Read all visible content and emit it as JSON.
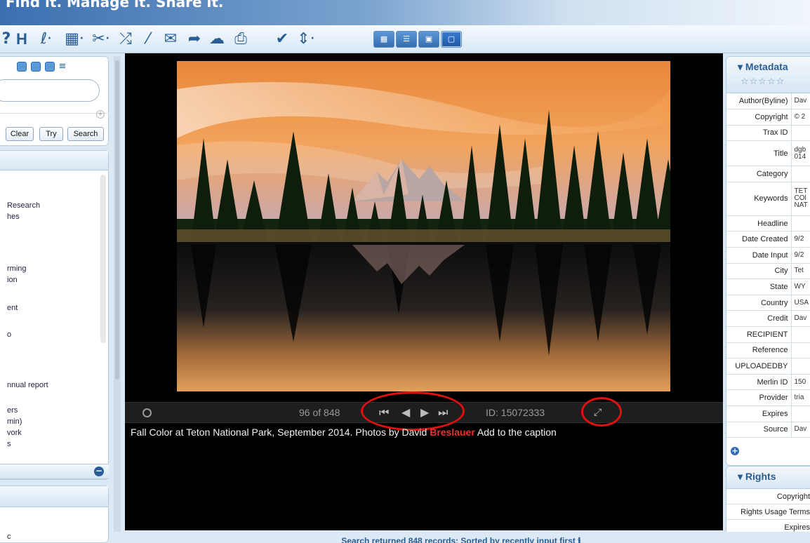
{
  "header": {
    "tagline": "Find it. Manage it. Share it."
  },
  "toolbar": {
    "icons": [
      "help-icon",
      "h-icon",
      "branch-icon",
      "calendar-icon",
      "scissors-icon",
      "shuffle-icon",
      "magic-wand-icon",
      "envelope-icon",
      "share-arrow-icon",
      "cloud-upload-icon",
      "printer-icon",
      "checkmark-icon",
      "sort-icon"
    ],
    "view_buttons": [
      "grid-view",
      "list-view",
      "image-view",
      "slideshow-view"
    ]
  },
  "left_panel": {
    "buttons": {
      "clear": "Clear",
      "try": "Try",
      "search": "Search"
    },
    "items": [
      "Research",
      "hes",
      "rming",
      "ion",
      "ent",
      "o",
      "nnual report",
      "ers",
      "min)",
      "vork",
      "s"
    ],
    "bottom_fragment": "c"
  },
  "viewer": {
    "counter": "96 of 848",
    "id_label": "ID: 15072333",
    "caption_before": "Fall Color at Teton National Park, September 2014. Photos by David ",
    "caption_highlight": "Breslauer",
    "caption_after": " Add to the caption"
  },
  "metadata": {
    "title": "Metadata",
    "stars": "☆☆☆☆☆",
    "rows": [
      {
        "key": "Author(Byline)",
        "value": "Dav"
      },
      {
        "key": "Copyright",
        "value": "© 2"
      },
      {
        "key": "Trax ID",
        "value": ""
      },
      {
        "key": "Title",
        "value": "dgb\n014"
      },
      {
        "key": "Category",
        "value": ""
      },
      {
        "key": "Keywords",
        "value": "TET\nCOl\nNAT"
      },
      {
        "key": "Headline",
        "value": ""
      },
      {
        "key": "Date Created",
        "value": "9/2"
      },
      {
        "key": "Date Input",
        "value": "9/2"
      },
      {
        "key": "City",
        "value": "Tet"
      },
      {
        "key": "State",
        "value": "WY"
      },
      {
        "key": "Country",
        "value": "USA"
      },
      {
        "key": "Credit",
        "value": "Dav"
      },
      {
        "key": "RECIPIENT",
        "value": ""
      },
      {
        "key": "Reference",
        "value": ""
      },
      {
        "key": "UPLOADEDBY",
        "value": ""
      },
      {
        "key": "Merlin ID",
        "value": "150"
      },
      {
        "key": "Provider",
        "value": "tria"
      },
      {
        "key": "Expires",
        "value": ""
      },
      {
        "key": "Source",
        "value": "Dav"
      }
    ]
  },
  "rights": {
    "title": "Rights",
    "rows": [
      "Copyright",
      "Rights Usage Terms",
      "Expires"
    ]
  },
  "status": {
    "text": "Search returned 848 records; Sorted by recently input first"
  }
}
